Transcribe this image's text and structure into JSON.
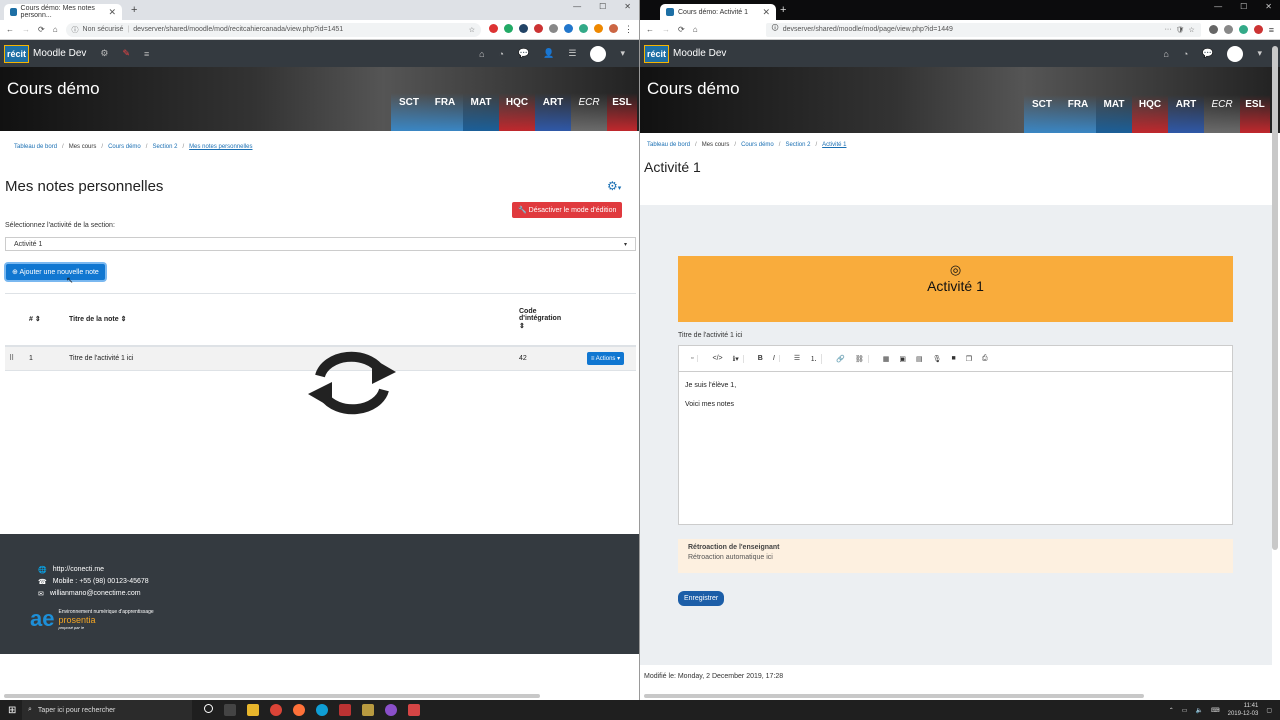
{
  "left": {
    "tab_title": "Cours démo: Mes notes personn...",
    "tab_close": "✕",
    "new_tab": "+",
    "window_controls": [
      "—",
      "☐",
      "✕"
    ],
    "security": "Non sécurisé",
    "url": "devserver/shared/moodle/mod/recitcahiercanada/view.php?id=1451",
    "logo": "récit",
    "brand": "Moodle Dev",
    "banner_title": "Cours démo",
    "subjects": [
      "SCT",
      "FRA",
      "MAT",
      "HQC",
      "ART",
      "ECR",
      "ESL"
    ],
    "breadcrumb": [
      "Tableau de bord",
      "Mes cours",
      "Cours démo",
      "Section 2",
      "Mes notes personnelles"
    ],
    "page_title": "Mes notes personnelles",
    "edit_button": "Désactiver le mode d'édition",
    "select_label": "Sélectionnez l'activité de la section:",
    "select_value": "Activité 1",
    "add_button": "Ajouter une nouvelle note",
    "table": {
      "headers": [
        "#",
        "Titre de la note",
        "Code d'intégration",
        ""
      ],
      "rows": [
        {
          "num": "1",
          "title": "Titre de l'activité 1 ici",
          "code": "42",
          "action": "Actions"
        }
      ]
    },
    "footer": {
      "website": "http://conecti.me",
      "mobile": "Mobile : +55 (98) 00123-45678",
      "email": "willianmano@conectime.com",
      "logo_caption": "Environnement numérique d'apprentissage",
      "logo_sub": "proposé par le",
      "logo_word": "prosentia"
    }
  },
  "right": {
    "tab_title": "Cours démo: Activité 1",
    "tab_close": "✕",
    "new_tab": "+",
    "window_controls": [
      "—",
      "☐",
      "✕"
    ],
    "url": "devserver/shared/moodle/mod/page/view.php?id=1449",
    "logo": "récit",
    "brand": "Moodle Dev",
    "banner_title": "Cours démo",
    "subjects": [
      "SCT",
      "FRA",
      "MAT",
      "HQC",
      "ART",
      "ECR",
      "ESL"
    ],
    "breadcrumb": [
      "Tableau de bord",
      "Mes cours",
      "Cours démo",
      "Section 2",
      "Activité 1"
    ],
    "page_title": "Activité 1",
    "activity_title": "Activité 1",
    "note_label": "Titre de l'activité 1 ici",
    "editor_lines": [
      "Je suis l'élève 1,",
      "Voici mes notes"
    ],
    "feedback_title": "Rétroaction de l'enseignant",
    "feedback_text": "Rétroaction automatique ici",
    "save_button": "Enregistrer",
    "modified": "Modifié le: Monday, 2 December 2019, 17:28"
  },
  "taskbar": {
    "search_placeholder": "Taper ici pour rechercher",
    "time": "11:41",
    "date": "2019-12-03"
  },
  "colors": {
    "navbar": "#343a40",
    "red_button": "#e03a3e",
    "blue_button": "#1177d1",
    "activity_header": "#f9ac3c",
    "feedback_bg": "#fdf0e0",
    "subject_colors": [
      "#3a86c4",
      "#3a86c4",
      "#1b5f99",
      "#c0282d",
      "#2f58a8",
      "#6b6b6b",
      "#c0282d"
    ]
  }
}
